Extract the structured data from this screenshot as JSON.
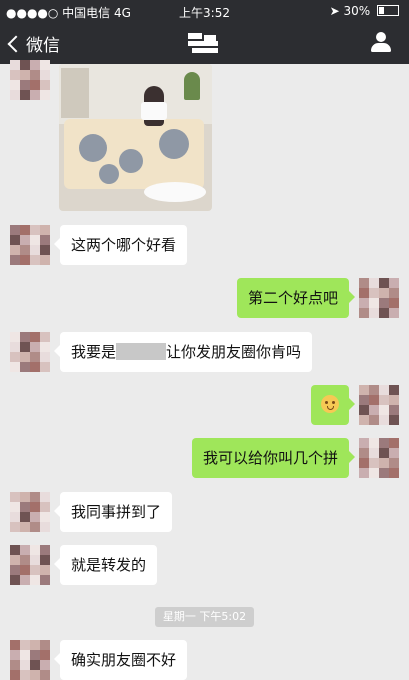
{
  "status_bar": {
    "carrier": "●●●●○ 中国电信 4G",
    "time": "上午3:52",
    "battery_text": "30%",
    "battery_level": 0.3
  },
  "nav": {
    "back_label": "微信",
    "back_icon": "chevron-left-icon",
    "profile_icon": "user-icon"
  },
  "messages": [
    {
      "side": "in",
      "type": "image",
      "text": ""
    },
    {
      "side": "in",
      "type": "text",
      "text": "这两个哪个好看"
    },
    {
      "side": "out",
      "type": "text",
      "text": "第二个好点吧"
    },
    {
      "side": "in",
      "type": "text",
      "text_before": "我要是",
      "text_after": "让你发朋友圈你肯吗"
    },
    {
      "side": "out",
      "type": "emoji",
      "text": "",
      "emoji": "flushed-face-icon"
    },
    {
      "side": "out",
      "type": "text",
      "text": "我可以给你叫几个拼"
    },
    {
      "side": "in",
      "type": "text",
      "text": "我同事拼到了"
    },
    {
      "side": "in",
      "type": "text",
      "text": "就是转发的"
    },
    {
      "side": "in",
      "type": "text",
      "text": "确实朋友圈不好"
    }
  ],
  "timestamp": "星期一 下午5:02",
  "colors": {
    "header": "#2c2d31",
    "background": "#ebebeb",
    "incoming_bubble": "#ffffff",
    "outgoing_bubble": "#9fe65a"
  }
}
